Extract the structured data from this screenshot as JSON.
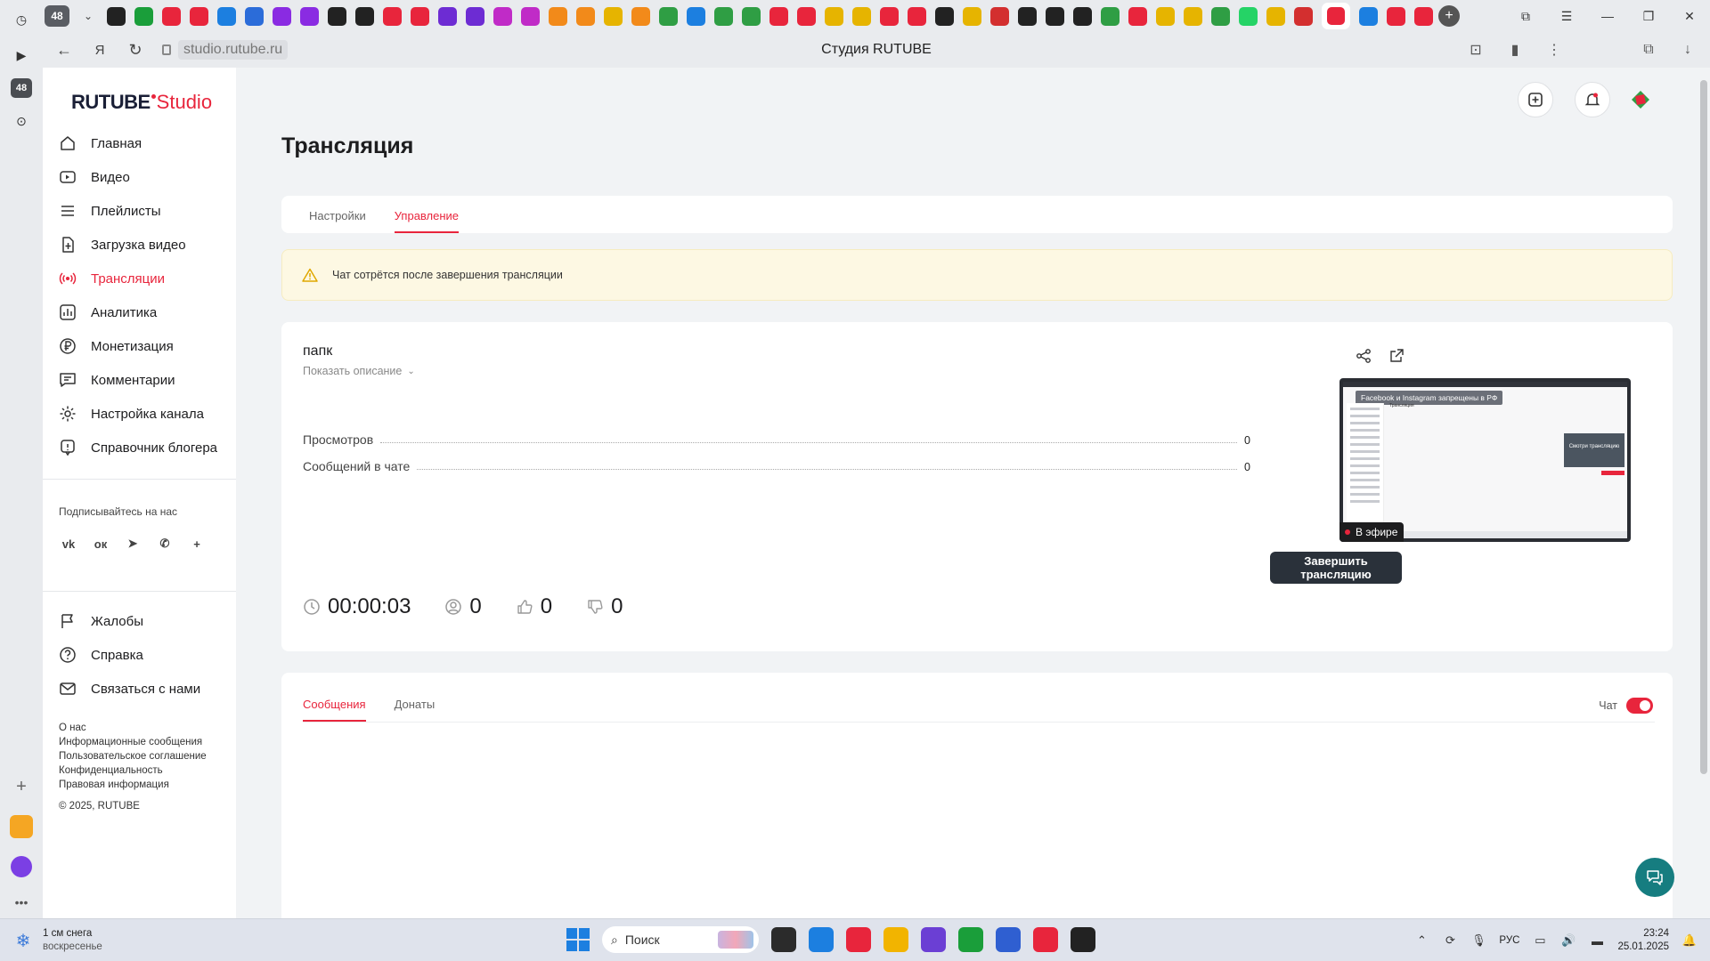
{
  "browser": {
    "tab_count": "48",
    "url": "studio.rutube.ru",
    "page_title": "Студия RUTUBE",
    "rail_badge": "48",
    "tab_icon_colors": [
      "#222",
      "#1a9e3a",
      "#e8253c",
      "#e8253c",
      "#1c7fe0",
      "#2b6cd9",
      "#8a2be2",
      "#8a2be2",
      "#222",
      "#222",
      "#e8253c",
      "#e8253c",
      "#6d2cd3",
      "#6d2cd3",
      "#c02bc7",
      "#c02bc7",
      "#f28a1a",
      "#f28a1a",
      "#e6b400",
      "#f28a1a",
      "#2f9e44",
      "#1c7fe0",
      "#2f9e44",
      "#2f9e44",
      "#e8253c",
      "#e8253c",
      "#e6b400",
      "#e6b400",
      "#e8253c",
      "#e8253c",
      "#222",
      "#e6b400",
      "#d32f2f",
      "#222",
      "#222",
      "#222",
      "#2f9e44",
      "#e8253c",
      "#e6b400",
      "#e6b400",
      "#2f9e44",
      "#25d366",
      "#e6b400",
      "#d32f2f",
      "#e8253c",
      "#1c7fe0",
      "#e8253c",
      "#e8253c"
    ]
  },
  "brand": {
    "name": "RUTUBE",
    "product": "Studio",
    "accent_color": "#e8253c"
  },
  "sidebar": {
    "items": [
      {
        "label": "Главная",
        "icon": "home-icon",
        "active": false
      },
      {
        "label": "Видео",
        "icon": "video-icon",
        "active": false
      },
      {
        "label": "Плейлисты",
        "icon": "playlist-icon",
        "active": false
      },
      {
        "label": "Загрузка видео",
        "icon": "upload-icon",
        "active": false
      },
      {
        "label": "Трансляции",
        "icon": "broadcast-icon",
        "active": true
      },
      {
        "label": "Аналитика",
        "icon": "analytics-icon",
        "active": false
      },
      {
        "label": "Монетизация",
        "icon": "ruble-icon",
        "active": false
      },
      {
        "label": "Комментарии",
        "icon": "comment-icon",
        "active": false
      },
      {
        "label": "Настройка канала",
        "icon": "settings-icon",
        "active": false
      },
      {
        "label": "Справочник блогера",
        "icon": "info-icon",
        "active": false
      }
    ],
    "subscribe_label": "Подписывайтесь на нас",
    "socials": [
      "vk-icon",
      "ok-icon",
      "telegram-icon",
      "viber-icon",
      "plus-icon"
    ],
    "secondary": [
      {
        "label": "Жалобы",
        "icon": "flag-icon"
      },
      {
        "label": "Справка",
        "icon": "help-icon"
      },
      {
        "label": "Связаться с нами",
        "icon": "mail-icon"
      }
    ],
    "footer_links": [
      "О нас",
      "Информационные сообщения",
      "Пользовательское соглашение",
      "Конфиденциальность",
      "Правовая информация"
    ],
    "copyright": "© 2025, RUTUBE"
  },
  "main": {
    "title": "Трансляция",
    "tabs": [
      {
        "label": "Настройки",
        "active": false
      },
      {
        "label": "Управление",
        "active": true
      }
    ],
    "warning": "Чат сотрётся после завершения трансляции",
    "stream": {
      "name": "папк",
      "show_description": "Показать описание",
      "stats": [
        {
          "label": "Просмотров",
          "value": "0"
        },
        {
          "label": "Сообщений в чате",
          "value": "0"
        }
      ],
      "timer": "00:00:03",
      "viewers": "0",
      "likes": "0",
      "dislikes": "0",
      "live_badge": "В эфире",
      "end_button": "Завершить трансляцию",
      "preview": {
        "banner": "Facebook и Instagram запрещены в РФ",
        "inner_title": "Трансляция",
        "inner_card": "Смотри трансляцию"
      }
    },
    "chat": {
      "tabs": [
        {
          "label": "Сообщения",
          "active": true
        },
        {
          "label": "Донаты",
          "active": false
        }
      ],
      "toggle_label": "Чат",
      "toggle_on": true
    }
  },
  "taskbar": {
    "weather_line1": "1 см снега",
    "weather_line2": "воскресенье",
    "search_placeholder": "Поиск",
    "language": "РУС",
    "time": "23:24",
    "date": "25.01.2025",
    "app_colors": [
      "#2b2b2b",
      "#1c7fe0",
      "#e8253c",
      "#f2b400",
      "#6b3fd4",
      "#1a9e3a",
      "#2f5fd1",
      "#e8253c",
      "#222"
    ]
  }
}
